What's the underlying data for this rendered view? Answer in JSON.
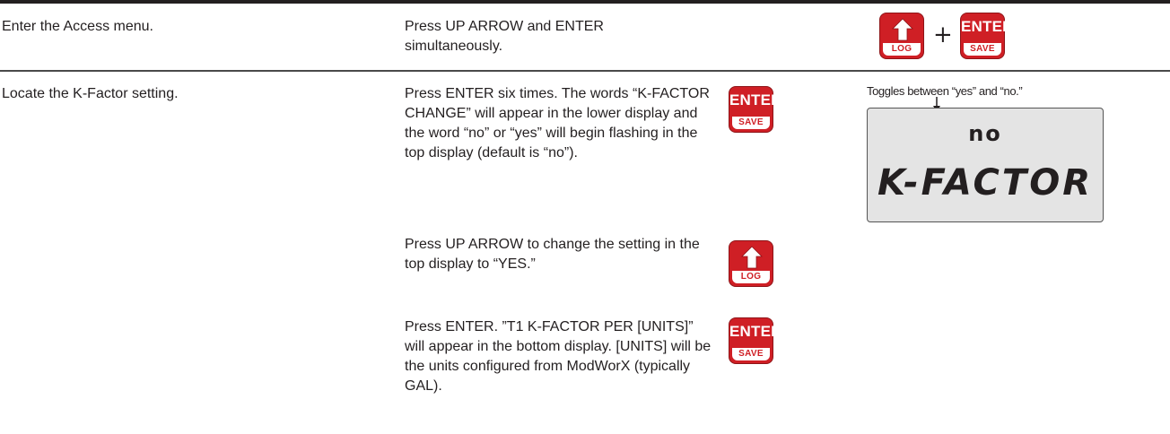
{
  "steps": [
    {
      "description": "Enter the Access menu.",
      "instruction": "Press UP ARROW and ENTER simultaneously.",
      "plus": "+"
    },
    {
      "description": "Locate the K-Factor setting.",
      "instructions": [
        "Press ENTER six times. The words “K-FACTOR CHANGE” will appear in the lower display and the word “no” or “yes” will begin flashing in the top display (default is “no”).",
        "Press UP ARROW to change the setting in the top display to “YES.”",
        "Press ENTER. ”T1 K-FACTOR PER [UNITS]” will appear in the bottom display. [UNITS] will be the units configured from ModWorX (typically GAL)."
      ]
    }
  ],
  "buttons": {
    "up_key": {
      "label": "LOG",
      "icon": "up-arrow-icon"
    },
    "enter_key": {
      "word": "ENTER",
      "label": "SAVE"
    }
  },
  "display": {
    "caption": "Toggles between “yes” and “no.”",
    "top": "no",
    "bottom": "K-FACTOR"
  },
  "colors": {
    "key_red": "#cf1f25",
    "lcd_bg": "#e4e4e4",
    "text": "#231f20"
  }
}
